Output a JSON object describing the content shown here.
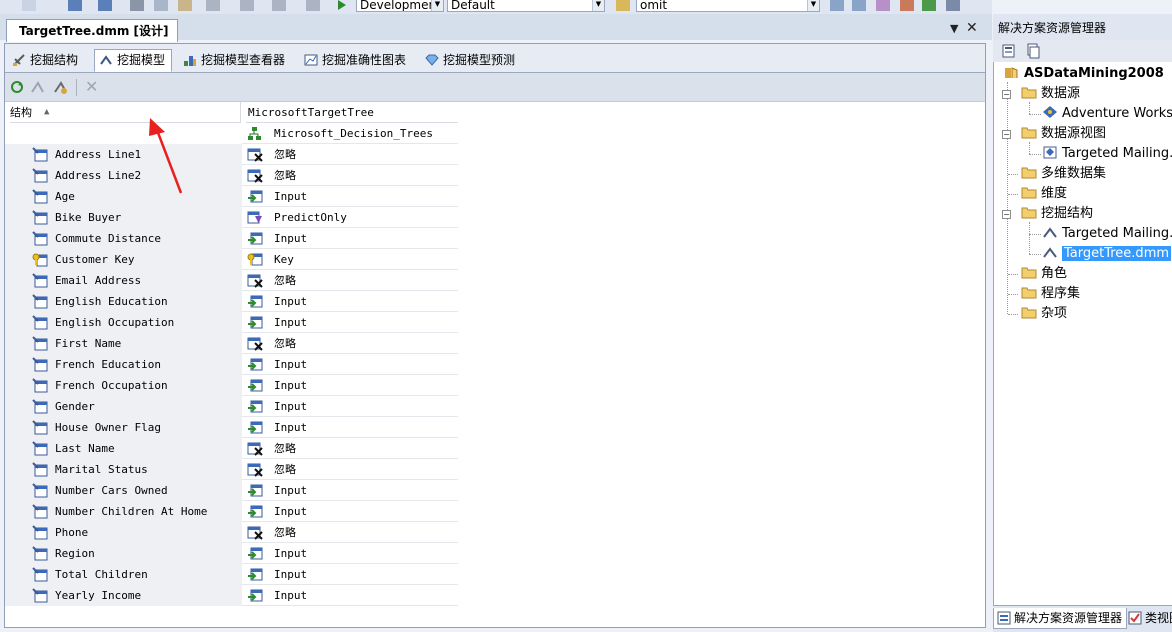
{
  "toolbar": {
    "config_combo": "Developmen",
    "platform_combo": "Default",
    "find_combo": "omit"
  },
  "document_tab": {
    "title": "TargetTree.dmm [设计]"
  },
  "designer_tabs": [
    {
      "label": "挖掘结构"
    },
    {
      "label": "挖掘模型"
    },
    {
      "label": "挖掘模型查看器"
    },
    {
      "label": "挖掘准确性图表"
    },
    {
      "label": "挖掘模型预测"
    }
  ],
  "grid": {
    "structure_header": "结构",
    "model_header": "MicrosoftTargetTree",
    "algorithm": "Microsoft_Decision_Trees",
    "rows": [
      {
        "column": "Address Line1",
        "usage": "忽略",
        "kind": "ignore"
      },
      {
        "column": "Address Line2",
        "usage": "忽略",
        "kind": "ignore"
      },
      {
        "column": "Age",
        "usage": "Input",
        "kind": "input"
      },
      {
        "column": "Bike Buyer",
        "usage": "PredictOnly",
        "kind": "predict"
      },
      {
        "column": "Commute Distance",
        "usage": "Input",
        "kind": "input"
      },
      {
        "column": "Customer Key",
        "usage": "Key",
        "kind": "key"
      },
      {
        "column": "Email Address",
        "usage": "忽略",
        "kind": "ignore"
      },
      {
        "column": "English Education",
        "usage": "Input",
        "kind": "input"
      },
      {
        "column": "English Occupation",
        "usage": "Input",
        "kind": "input"
      },
      {
        "column": "First Name",
        "usage": "忽略",
        "kind": "ignore"
      },
      {
        "column": "French Education",
        "usage": "Input",
        "kind": "input"
      },
      {
        "column": "French Occupation",
        "usage": "Input",
        "kind": "input"
      },
      {
        "column": "Gender",
        "usage": "Input",
        "kind": "input"
      },
      {
        "column": "House Owner Flag",
        "usage": "Input",
        "kind": "input"
      },
      {
        "column": "Last Name",
        "usage": "忽略",
        "kind": "ignore"
      },
      {
        "column": "Marital Status",
        "usage": "忽略",
        "kind": "ignore"
      },
      {
        "column": "Number Cars Owned",
        "usage": "Input",
        "kind": "input"
      },
      {
        "column": "Number Children At Home",
        "usage": "Input",
        "kind": "input"
      },
      {
        "column": "Phone",
        "usage": "忽略",
        "kind": "ignore"
      },
      {
        "column": "Region",
        "usage": "Input",
        "kind": "input"
      },
      {
        "column": "Total Children",
        "usage": "Input",
        "kind": "input"
      },
      {
        "column": "Yearly Income",
        "usage": "Input",
        "kind": "input"
      }
    ]
  },
  "solution_explorer": {
    "title": "解决方案资源管理器",
    "project": "ASDataMining2008",
    "nodes": [
      {
        "label": "数据源"
      },
      {
        "label": "Adventure Works DW"
      },
      {
        "label": "数据源视图"
      },
      {
        "label": "Targeted Mailing.dsv"
      },
      {
        "label": "多维数据集"
      },
      {
        "label": "维度"
      },
      {
        "label": "挖掘结构"
      },
      {
        "label": "Targeted Mailing.dmm"
      },
      {
        "label": "TargetTree.dmm"
      },
      {
        "label": "角色"
      },
      {
        "label": "程序集"
      },
      {
        "label": "杂项"
      }
    ],
    "bottom_tabs": [
      {
        "label": "解决方案资源管理器"
      },
      {
        "label": "类视图"
      }
    ]
  },
  "colors": {
    "selection": "#3399ff",
    "annotation_arrow": "#e8211e"
  }
}
